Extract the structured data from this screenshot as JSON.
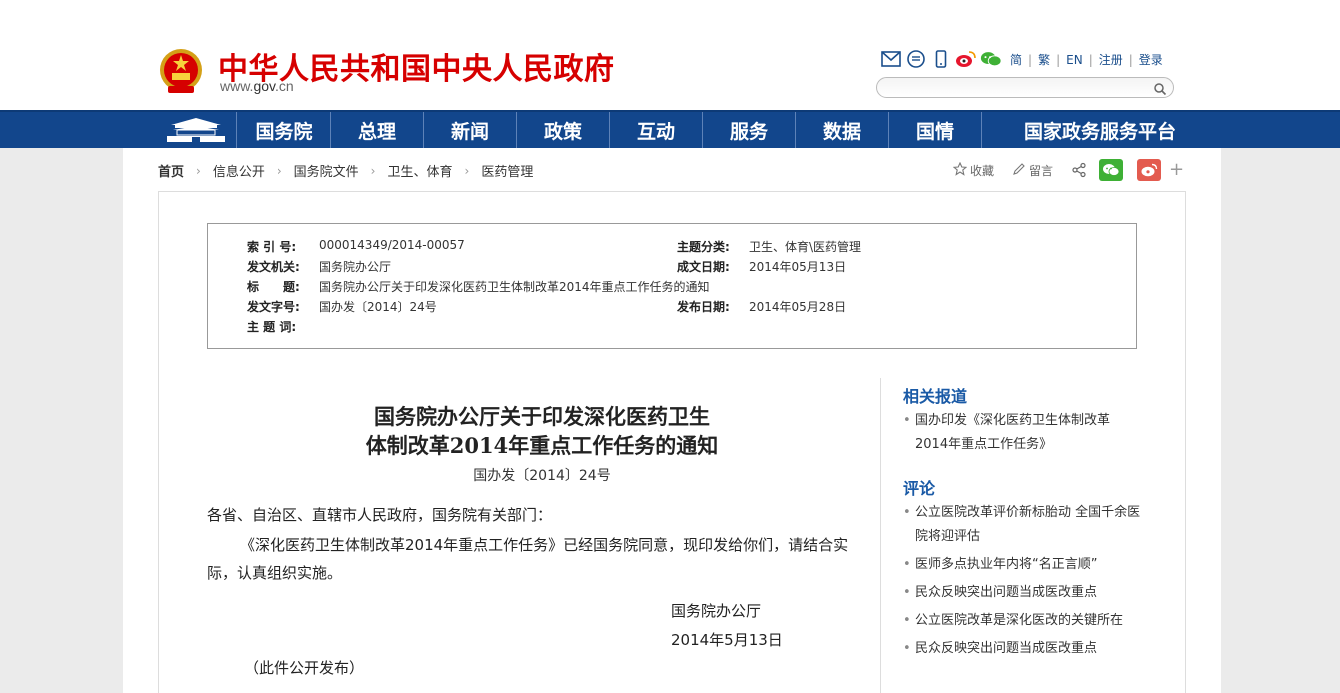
{
  "header": {
    "site_title": "中华人民共和国中央人民政府",
    "domain_prefix": "www.",
    "domain_bold": "gov",
    "domain_suffix": ".cn",
    "lang_links": [
      "简",
      "繁",
      "EN",
      "注册",
      "登录"
    ],
    "search_placeholder": ""
  },
  "nav": {
    "items": [
      "国务院",
      "总理",
      "新闻",
      "政策",
      "互动",
      "服务",
      "数据",
      "国情",
      "国家政务服务平台"
    ]
  },
  "breadcrumb": [
    "首页",
    "信息公开",
    "国务院文件",
    "卫生、体育",
    "医药管理"
  ],
  "share": {
    "favorite": "收藏",
    "comment": "留言"
  },
  "doc_info": {
    "index_label": "索 引 号:",
    "index_value": "000014349/2014-00057",
    "category_label": "主题分类:",
    "category_value": "卫生、体育\\医药管理",
    "issuer_label": "发文机关:",
    "issuer_value": "国务院办公厅",
    "created_label": "成文日期:",
    "created_value": "2014年05月13日",
    "title_label": "标　　题:",
    "title_value": "国务院办公厅关于印发深化医药卫生体制改革2014年重点工作任务的通知",
    "docno_label": "发文字号:",
    "docno_value": "国办发〔2014〕24号",
    "published_label": "发布日期:",
    "published_value": "2014年05月28日",
    "keywords_label": "主 题 词:",
    "keywords_value": ""
  },
  "article": {
    "title_line1": "国务院办公厅关于印发深化医药卫生",
    "title_line2": "体制改革2014年重点工作任务的通知",
    "doc_number": "国办发〔2014〕24号",
    "addressee": "各省、自治区、直辖市人民政府，国务院有关部门：",
    "body": "《深化医药卫生体制改革2014年重点工作任务》已经国务院同意，现印发给你们，请结合实际，认真组织实施。",
    "signer": "国务院办公厅",
    "date": "2014年5月13日",
    "note": "（此件公开发布）"
  },
  "sidebar": {
    "related_heading": "相关报道",
    "related_items": [
      "国办印发《深化医药卫生体制改革2014年重点工作任务》"
    ],
    "comments_heading": "评论",
    "comment_items": [
      "公立医院改革评价新标胎动 全国千余医院将迎评估",
      "医师多点执业年内将“名正言顺”",
      "民众反映突出问题当成医改重点",
      "公立医院改革是深化医改的关键所在",
      "民众反映突出问题当成医改重点"
    ]
  },
  "colors": {
    "title_red": "#d60000",
    "nav_blue": "#12468c",
    "link_blue": "#1a5aa6",
    "wechat_green": "#3eb035",
    "weibo_red": "#e6162d"
  }
}
